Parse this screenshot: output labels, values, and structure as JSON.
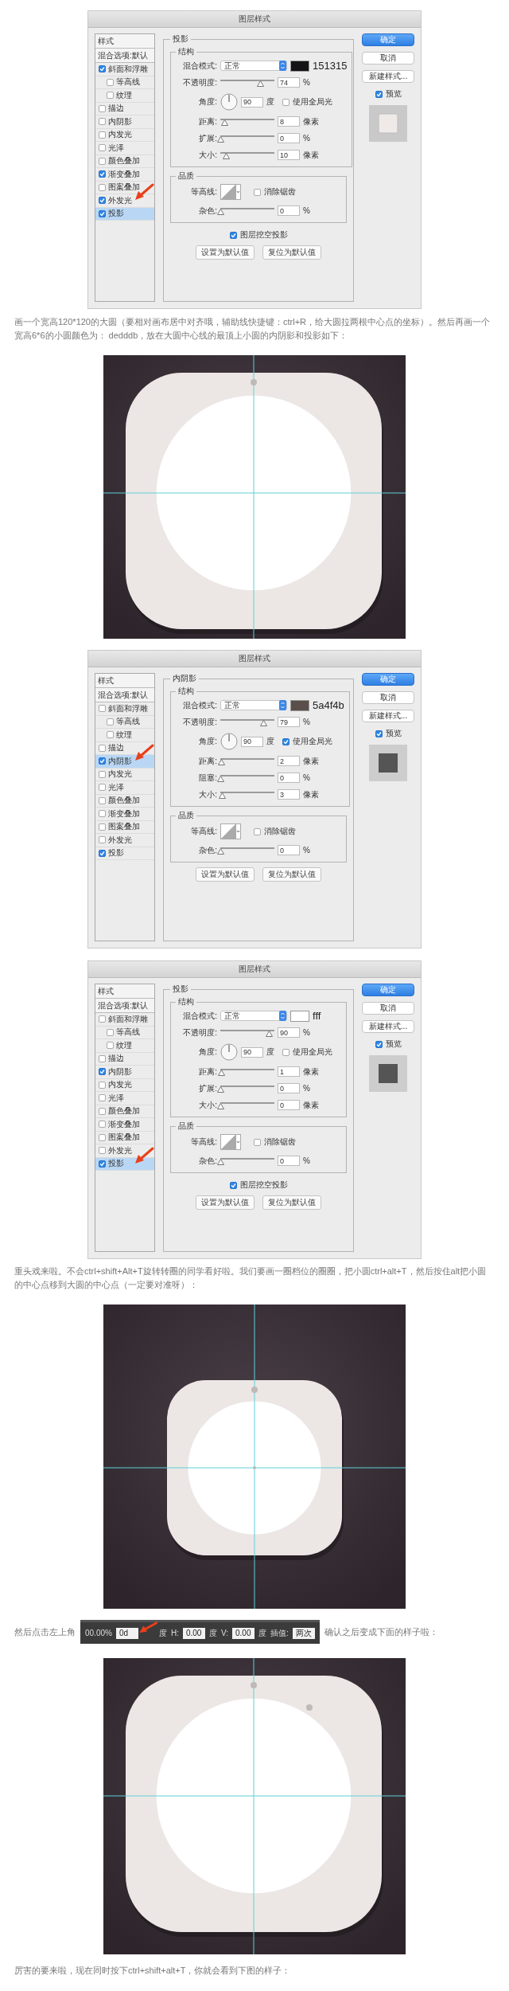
{
  "blocks": [
    {
      "kind": "dialog",
      "title": "图层样式",
      "list_header": "样式",
      "blend_options": "混合选项:默认",
      "styles": [
        {
          "label": "斜面和浮雕",
          "checked": true,
          "selected": false,
          "arrow": false,
          "children": [
            {
              "label": "等高线",
              "checked": false,
              "selected": false,
              "arrow": false
            },
            {
              "label": "纹理",
              "checked": false,
              "selected": false,
              "arrow": false
            }
          ]
        },
        {
          "label": "描边",
          "checked": false,
          "selected": false,
          "arrow": false
        },
        {
          "label": "内阴影",
          "checked": false,
          "selected": false,
          "arrow": false
        },
        {
          "label": "内发光",
          "checked": false,
          "selected": false,
          "arrow": false
        },
        {
          "label": "光泽",
          "checked": false,
          "selected": false,
          "arrow": false
        },
        {
          "label": "颜色叠加",
          "checked": false,
          "selected": false,
          "arrow": false
        },
        {
          "label": "渐变叠加",
          "checked": true,
          "selected": false,
          "arrow": false
        },
        {
          "label": "图案叠加",
          "checked": false,
          "selected": false,
          "arrow": false
        },
        {
          "label": "外发光",
          "checked": true,
          "selected": false,
          "arrow": true
        },
        {
          "label": "投影",
          "checked": true,
          "selected": true,
          "arrow": false
        }
      ],
      "section": "投影",
      "structure": {
        "title": "结构",
        "blend": {
          "label": "混合模式:",
          "value": "正常",
          "hex": "151315"
        },
        "rows": [
          {
            "kind": "slider",
            "label": "不透明度:",
            "level": 0.74,
            "value": "74",
            "unit": "%"
          },
          {
            "kind": "angle",
            "label": "角度:",
            "value": "90",
            "unit": "度",
            "checkbox": {
              "label": "使用全局光",
              "checked": false
            }
          },
          {
            "kind": "slider",
            "label": "距离:",
            "level": 0.08,
            "value": "8",
            "unit": "像素"
          },
          {
            "kind": "slider",
            "label": "扩展:",
            "level": 0,
            "value": "0",
            "unit": "%"
          },
          {
            "kind": "slider",
            "label": "大小:",
            "level": 0.1,
            "value": "10",
            "unit": "像素"
          }
        ]
      },
      "quality": {
        "title": "品质",
        "contour_label": "等高线:",
        "antialias": {
          "label": "消除锯齿",
          "checked": false
        },
        "noise": {
          "label": "杂色:",
          "level": 0,
          "value": "0",
          "unit": "%"
        }
      },
      "knockout": {
        "label": "图层挖空投影",
        "checked": true
      },
      "default_buttons": [
        "设置为默认值",
        "复位为默认值"
      ],
      "buttons": [
        {
          "label": "确定",
          "primary": true
        },
        {
          "label": "取消",
          "primary": false
        },
        {
          "label": "新建样式...",
          "primary": false
        }
      ],
      "preview": {
        "label": "预览",
        "checked": true,
        "kind": "light"
      }
    },
    {
      "kind": "paragraph",
      "text": "画一个宽高120*120的大圆（要相对画布居中对齐哦，辅助线快捷键：ctrl+R，给大圆拉两根中心点的坐标）。然后再画一个宽高6*6的小圆颜色为： dedddb，放在大圆中心线的最顶上小圆的内阴影和投影如下："
    },
    {
      "kind": "picture"
    },
    {
      "kind": "dialog",
      "title": "图层样式",
      "list_header": "样式",
      "blend_options": "混合选项:默认",
      "styles": [
        {
          "label": "斜面和浮雕",
          "checked": false,
          "selected": false,
          "arrow": false,
          "children": [
            {
              "label": "等高线",
              "checked": false,
              "selected": false,
              "arrow": false
            },
            {
              "label": "纹理",
              "checked": false,
              "selected": false,
              "arrow": false
            }
          ]
        },
        {
          "label": "描边",
          "checked": false,
          "selected": false,
          "arrow": false
        },
        {
          "label": "内阴影",
          "checked": true,
          "selected": true,
          "arrow": true
        },
        {
          "label": "内发光",
          "checked": false,
          "selected": false,
          "arrow": false
        },
        {
          "label": "光泽",
          "checked": false,
          "selected": false,
          "arrow": false
        },
        {
          "label": "颜色叠加",
          "checked": false,
          "selected": false,
          "arrow": false
        },
        {
          "label": "渐变叠加",
          "checked": false,
          "selected": false,
          "arrow": false
        },
        {
          "label": "图案叠加",
          "checked": false,
          "selected": false,
          "arrow": false
        },
        {
          "label": "外发光",
          "checked": false,
          "selected": false,
          "arrow": false
        },
        {
          "label": "投影",
          "checked": true,
          "selected": false,
          "arrow": false
        }
      ],
      "section": "内阴影",
      "structure": {
        "title": "结构",
        "blend": {
          "label": "混合模式:",
          "value": "正常",
          "hex": "5a4f4b"
        },
        "rows": [
          {
            "kind": "slider",
            "label": "不透明度:",
            "level": 0.79,
            "value": "79",
            "unit": "%"
          },
          {
            "kind": "angle",
            "label": "角度:",
            "value": "90",
            "unit": "度",
            "checkbox": {
              "label": "使用全局光",
              "checked": true
            }
          },
          {
            "kind": "slider",
            "label": "距离:",
            "level": 0.02,
            "value": "2",
            "unit": "像素"
          },
          {
            "kind": "slider",
            "label": "阻塞:",
            "level": 0,
            "value": "0",
            "unit": "%"
          },
          {
            "kind": "slider",
            "label": "大小:",
            "level": 0.03,
            "value": "3",
            "unit": "像素"
          }
        ]
      },
      "quality": {
        "title": "品质",
        "contour_label": "等高线:",
        "antialias": {
          "label": "消除锯齿",
          "checked": false
        },
        "noise": {
          "label": "杂色:",
          "level": 0,
          "value": "0",
          "unit": "%"
        }
      },
      "default_buttons": [
        "设置为默认值",
        "复位为默认值"
      ],
      "buttons": [
        {
          "label": "确定",
          "primary": true
        },
        {
          "label": "取消",
          "primary": false
        },
        {
          "label": "新建样式...",
          "primary": false
        }
      ],
      "preview": {
        "label": "预览",
        "checked": true,
        "kind": "dark"
      }
    },
    {
      "kind": "dialog",
      "title": "图层样式",
      "list_header": "样式",
      "blend_options": "混合选项:默认",
      "styles": [
        {
          "label": "斜面和浮雕",
          "checked": false,
          "selected": false,
          "arrow": false,
          "children": [
            {
              "label": "等高线",
              "checked": false,
              "selected": false,
              "arrow": false
            },
            {
              "label": "纹理",
              "checked": false,
              "selected": false,
              "arrow": false
            }
          ]
        },
        {
          "label": "描边",
          "checked": false,
          "selected": false,
          "arrow": false
        },
        {
          "label": "内阴影",
          "checked": true,
          "selected": false,
          "arrow": false
        },
        {
          "label": "内发光",
          "checked": false,
          "selected": false,
          "arrow": false
        },
        {
          "label": "光泽",
          "checked": false,
          "selected": false,
          "arrow": false
        },
        {
          "label": "颜色叠加",
          "checked": false,
          "selected": false,
          "arrow": false
        },
        {
          "label": "渐变叠加",
          "checked": false,
          "selected": false,
          "arrow": false
        },
        {
          "label": "图案叠加",
          "checked": false,
          "selected": false,
          "arrow": false
        },
        {
          "label": "外发光",
          "checked": false,
          "selected": false,
          "arrow": false
        },
        {
          "label": "投影",
          "checked": true,
          "selected": true,
          "arrow": true
        }
      ],
      "section": "投影",
      "structure": {
        "title": "结构",
        "blend": {
          "label": "混合模式:",
          "value": "正常",
          "hex": "fff"
        },
        "rows": [
          {
            "kind": "slider",
            "label": "不透明度:",
            "level": 0.9,
            "value": "90",
            "unit": "%"
          },
          {
            "kind": "angle",
            "label": "角度:",
            "value": "90",
            "unit": "度",
            "checkbox": {
              "label": "使用全局光",
              "checked": false
            }
          },
          {
            "kind": "slider",
            "label": "距离:",
            "level": 0.01,
            "value": "1",
            "unit": "像素"
          },
          {
            "kind": "slider",
            "label": "扩展:",
            "level": 0,
            "value": "0",
            "unit": "%"
          },
          {
            "kind": "slider",
            "label": "大小:",
            "level": 0,
            "value": "0",
            "unit": "像素"
          }
        ]
      },
      "quality": {
        "title": "品质",
        "contour_label": "等高线:",
        "antialias": {
          "label": "消除锯齿",
          "checked": false
        },
        "noise": {
          "label": "杂色:",
          "level": 0,
          "value": "0",
          "unit": "%"
        }
      },
      "knockout": {
        "label": "图层挖空投影",
        "checked": true
      },
      "default_buttons": [
        "设置为默认值",
        "复位为默认值"
      ],
      "buttons": [
        {
          "label": "确定",
          "primary": true
        },
        {
          "label": "取消",
          "primary": false
        },
        {
          "label": "新建样式...",
          "primary": false
        }
      ],
      "preview": {
        "label": "预览",
        "checked": true,
        "kind": "dark"
      }
    },
    {
      "kind": "paragraph",
      "text": "重头戏来啦。不会ctrl+shift+Alt+T旋转转圈的同学看好啦。我们要画一圈档位的圈圈，把小圆ctrl+alt+T，然后按住alt把小圆的中心点移到大圆的中心点（一定要对准呀）："
    },
    {
      "kind": "picture"
    },
    {
      "kind": "toolbar_line",
      "before": "然后点击左上角",
      "after": "确认之后变成下面的样子啦：",
      "toolbar": [
        {
          "kind": "text",
          "text": "00.00%"
        },
        {
          "kind": "field",
          "text": "0d"
        },
        {
          "kind": "arrow"
        },
        {
          "kind": "text",
          "text": "度"
        },
        {
          "kind": "text",
          "text": "H:"
        },
        {
          "kind": "field",
          "text": "0.00"
        },
        {
          "kind": "text",
          "text": "度"
        },
        {
          "kind": "text",
          "text": "V:"
        },
        {
          "kind": "field",
          "text": "0.00"
        },
        {
          "kind": "text",
          "text": "度"
        },
        {
          "kind": "text",
          "text": "插值:"
        },
        {
          "kind": "field",
          "text": "两次"
        }
      ]
    },
    {
      "kind": "picture"
    },
    {
      "kind": "paragraph",
      "text": "厉害的要来啦，现在同时按下ctrl+shift+alt+T，你就会看到下图的样子："
    }
  ]
}
